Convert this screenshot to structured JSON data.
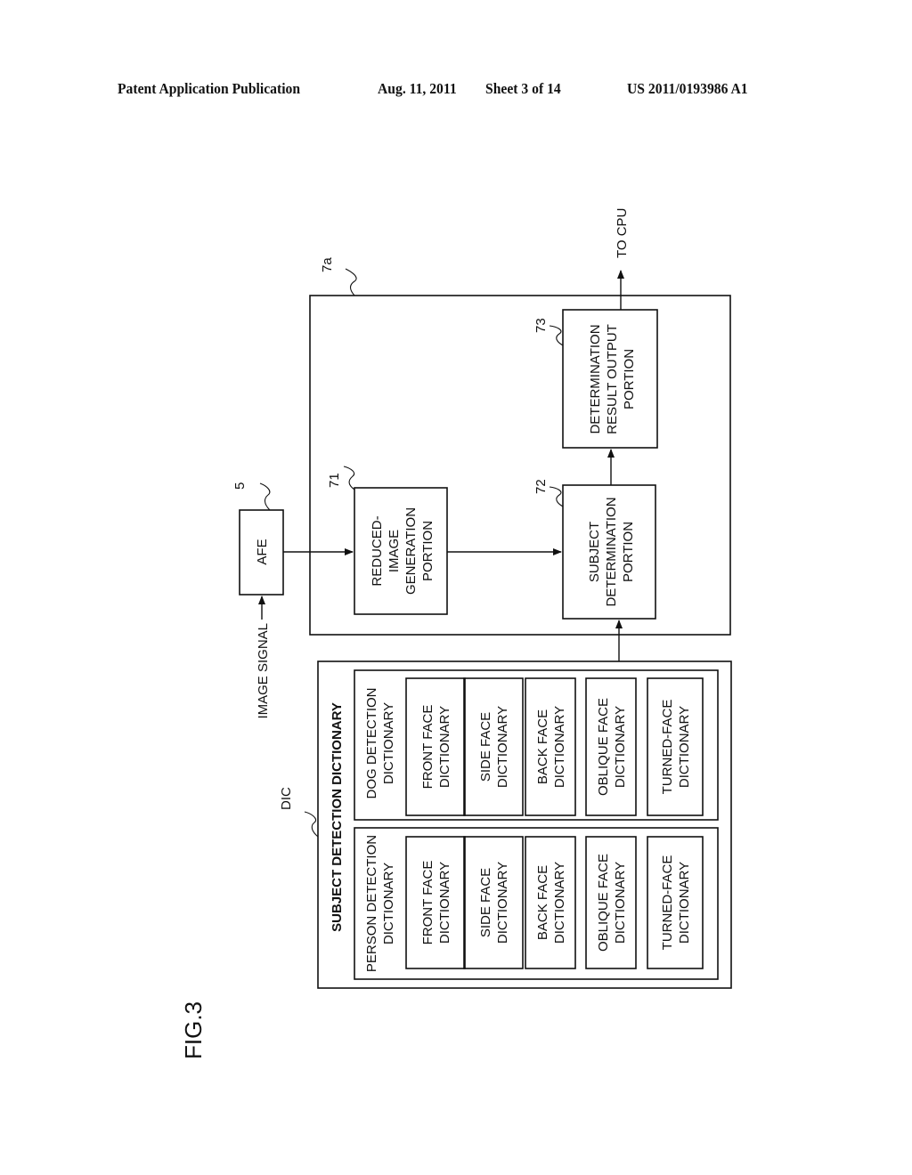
{
  "header": {
    "publication": "Patent Application Publication",
    "date": "Aug. 11, 2011",
    "sheet": "Sheet 3 of 14",
    "number": "US 2011/0193986 A1"
  },
  "figure": {
    "label": "FIG.3",
    "orientation": "rotated 90 degrees counterclockwise"
  },
  "external": {
    "input_label": "IMAGE SIGNAL",
    "output_label": "TO CPU",
    "afe": {
      "ref": "5",
      "label": "AFE"
    }
  },
  "unit": {
    "ref": "7a",
    "blocks": [
      {
        "ref": "71",
        "lines": [
          "REDUCED-",
          "IMAGE",
          "GENERATION",
          "PORTION"
        ]
      },
      {
        "ref": "72",
        "lines": [
          "SUBJECT",
          "DETERMINATION",
          "PORTION"
        ]
      },
      {
        "ref": "73",
        "lines": [
          "DETERMINATION",
          "RESULT OUTPUT",
          "PORTION"
        ]
      }
    ]
  },
  "dictionary": {
    "ref": "DIC",
    "title": "SUBJECT DETECTION DICTIONARY",
    "groups": [
      {
        "title_lines": [
          "PERSON DETECTION",
          "DICTIONARY"
        ],
        "items": [
          [
            "FRONT FACE",
            "DICTIONARY"
          ],
          [
            "SIDE FACE",
            "DICTIONARY"
          ],
          [
            "BACK FACE",
            "DICTIONARY"
          ],
          [
            "OBLIQUE FACE",
            "DICTIONARY"
          ],
          [
            "TURNED-FACE",
            "DICTIONARY"
          ]
        ]
      },
      {
        "title_lines": [
          "DOG DETECTION",
          "DICTIONARY"
        ],
        "items": [
          [
            "FRONT FACE",
            "DICTIONARY"
          ],
          [
            "SIDE FACE",
            "DICTIONARY"
          ],
          [
            "BACK FACE",
            "DICTIONARY"
          ],
          [
            "OBLIQUE FACE",
            "DICTIONARY"
          ],
          [
            "TURNED-FACE",
            "DICTIONARY"
          ]
        ]
      }
    ]
  }
}
